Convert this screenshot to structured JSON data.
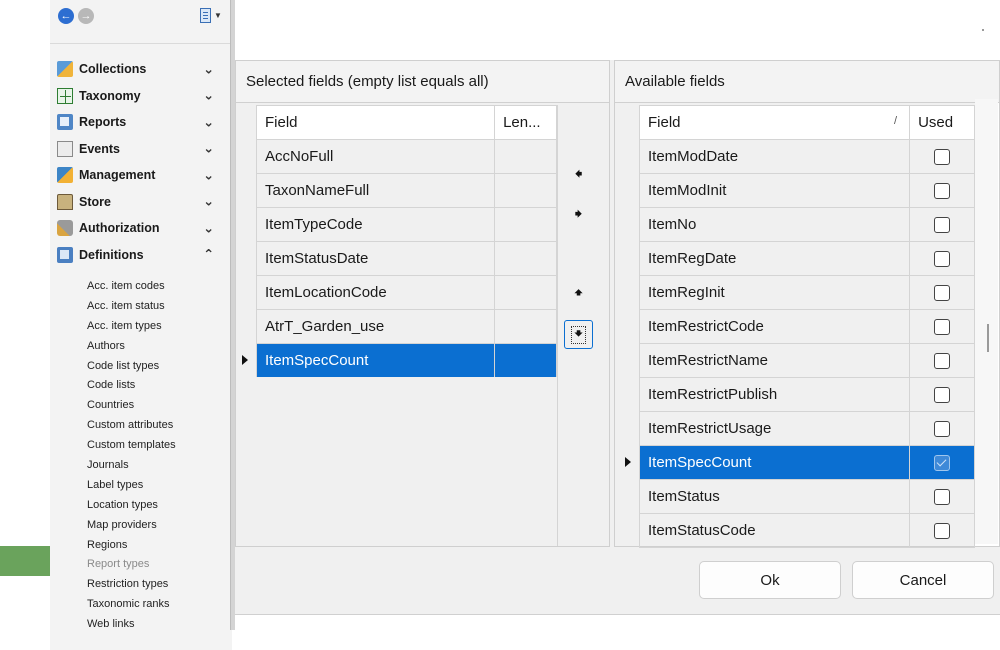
{
  "sidebar": {
    "toolbar": {
      "back_icon": "arrow-left-circle-icon",
      "forward_icon": "arrow-right-circle-icon",
      "menu_icon": "document-menu-icon"
    },
    "groups": [
      {
        "label": "Collections",
        "icon": "collections-icon",
        "chevron": "»"
      },
      {
        "label": "Taxonomy",
        "icon": "taxonomy-icon",
        "chevron": "»"
      },
      {
        "label": "Reports",
        "icon": "reports-icon",
        "chevron": "»"
      },
      {
        "label": "Events",
        "icon": "events-icon",
        "chevron": "»"
      },
      {
        "label": "Management",
        "icon": "management-icon",
        "chevron": "»"
      },
      {
        "label": "Store",
        "icon": "store-icon",
        "chevron": "»"
      },
      {
        "label": "Authorization",
        "icon": "authorization-icon",
        "chevron": "»"
      },
      {
        "label": "Definitions",
        "icon": "definitions-icon",
        "chevron": "«",
        "expanded": true
      }
    ],
    "definitions_items": [
      "Acc. item codes",
      "Acc. item status",
      "Acc. item types",
      "Authors",
      "Code list types",
      "Code lists",
      "Countries",
      "Custom attributes",
      "Custom templates",
      "Journals",
      "Label types",
      "Location types",
      "Map providers",
      "Regions",
      "Report types",
      "Restriction types",
      "Taxonomic ranks",
      "Web links"
    ],
    "highlighted_item": "Report types"
  },
  "selected_panel": {
    "title": "Selected fields (empty list equals all)",
    "columns": [
      "Field",
      "Len..."
    ],
    "rows": [
      {
        "field": "AccNoFull",
        "len": ""
      },
      {
        "field": "TaxonNameFull",
        "len": ""
      },
      {
        "field": "ItemTypeCode",
        "len": ""
      },
      {
        "field": "ItemStatusDate",
        "len": ""
      },
      {
        "field": "ItemLocationCode",
        "len": ""
      },
      {
        "field": "AtrT_Garden_use",
        "len": ""
      },
      {
        "field": "ItemSpecCount",
        "len": ""
      }
    ],
    "selected_index": 6
  },
  "move_buttons": {
    "add_icon": "arrow-left-icon",
    "remove_icon": "arrow-right-icon",
    "up_icon": "arrow-up-icon",
    "down_icon": "arrow-down-icon"
  },
  "available_panel": {
    "title": "Available fields",
    "columns": [
      "Field",
      "Used"
    ],
    "rows": [
      {
        "field": "ItemModDate",
        "used": false
      },
      {
        "field": "ItemModInit",
        "used": false
      },
      {
        "field": "ItemNo",
        "used": false
      },
      {
        "field": "ItemRegDate",
        "used": false
      },
      {
        "field": "ItemRegInit",
        "used": false
      },
      {
        "field": "ItemRestrictCode",
        "used": false
      },
      {
        "field": "ItemRestrictName",
        "used": false
      },
      {
        "field": "ItemRestrictPublish",
        "used": false
      },
      {
        "field": "ItemRestrictUsage",
        "used": false
      },
      {
        "field": "ItemSpecCount",
        "used": true
      },
      {
        "field": "ItemStatus",
        "used": false
      },
      {
        "field": "ItemStatusCode",
        "used": false
      }
    ],
    "selected_index": 9
  },
  "buttons": {
    "ok": "Ok",
    "cancel": "Cancel"
  },
  "colors": {
    "selection": "#0b6fd1",
    "nav_back": "#2d6ed1",
    "annotation_arrow": "#6aa35c"
  }
}
